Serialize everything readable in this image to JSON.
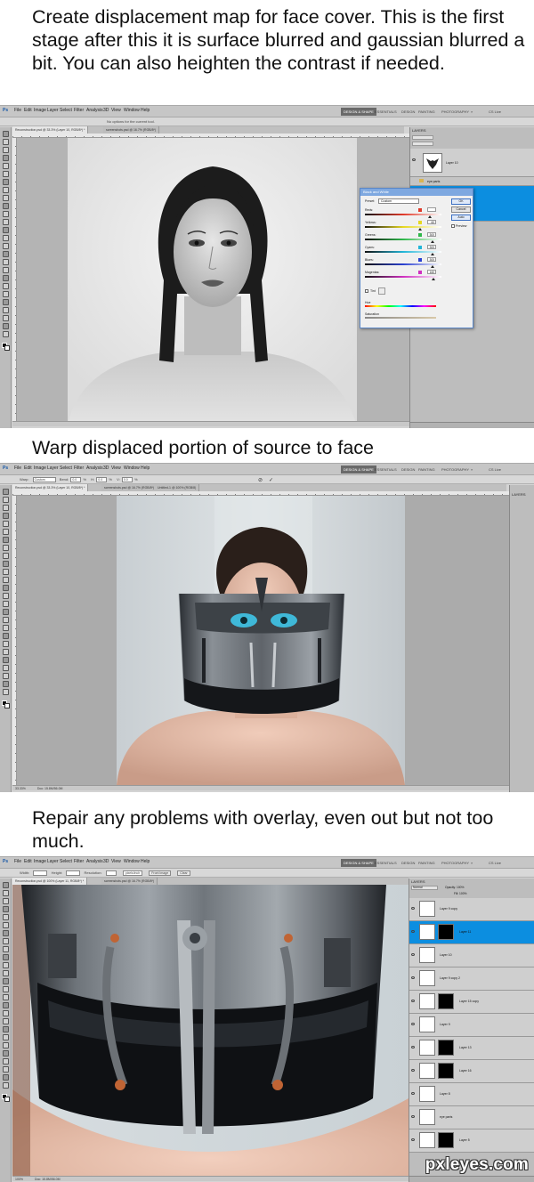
{
  "captions": {
    "step1": "Create displacement map for face cover. This is the first stage after this it is surface blurred and gaussian blurred a bit. You can also heighten the contrast if needed.",
    "step2": "Warp displaced portion of source to face",
    "step3": "Repair any problems with overlay, even out but not too much."
  },
  "ps_menu": [
    "Ps",
    "File",
    "Edit",
    "Image",
    "Layer",
    "Select",
    "Filter",
    "Analysis",
    "3D",
    "View",
    "Window",
    "Help"
  ],
  "workspace": {
    "active": "DESIGN & SHAPE",
    "items": [
      "ESSENTIALS",
      "DESIGN",
      "PAINTING",
      "PHOTOGRAPHY",
      "»"
    ],
    "cslive": "CS Live"
  },
  "screen1": {
    "options_hint": "No options for the current tool.",
    "tabs": [
      "Reconstruction.psd @ 33.3% (Layer 10, RGB/8*) *",
      "screenshots.psd @ 16.7% (RGB/8*)"
    ],
    "layers_title": "LAYERS",
    "layers": [
      {
        "name": "Layer 10",
        "thumb": "mask-icon"
      },
      {
        "name": "eye parts",
        "thumb": "folder-icon"
      },
      {
        "name": "",
        "thumb": "face-icon",
        "selected": true
      }
    ],
    "dialog": {
      "title": "Black and White",
      "preset_label": "Preset:",
      "preset_value": "Custom",
      "buttons": [
        "OK",
        "Cancel",
        "Auto"
      ],
      "preview_label": "Preview",
      "sliders": [
        {
          "label": "Reds:",
          "value": "",
          "color": "#e03a2a",
          "pct": 0.85
        },
        {
          "label": "Yellows:",
          "value": "60",
          "color": "#e6d820",
          "pct": 0.72
        },
        {
          "label": "Greens:",
          "value": "300",
          "color": "#2fb84a",
          "pct": 0.88
        },
        {
          "label": "Cyans:",
          "value": "300",
          "color": "#22b6d8",
          "pct": 0.88
        },
        {
          "label": "Blues:",
          "value": "300",
          "color": "#2a40d0",
          "pct": 0.88
        },
        {
          "label": "Magentas:",
          "value": "160",
          "color": "#d030c0",
          "pct": 0.9
        }
      ],
      "tint_label": "Tint",
      "hue_label": "Hue",
      "saturation_label": "Saturation"
    }
  },
  "screen2": {
    "options": [
      "Warp:",
      "Custom",
      "Bend:",
      "0.0",
      "%",
      "H:",
      "0.0",
      "%",
      "V:",
      "0.0",
      "%"
    ],
    "tabs": [
      "Reconstruction.psd @ 33.3% (Layer 10, RGB/8*) *",
      "screenshots.psd @ 16.7% (RGB/8*)",
      "Untitled-1 @ 100% (RGB/8)"
    ],
    "panel_title": "LAYERS",
    "zoom": "33.33%",
    "doc": "Doc: 15.8M/56.0M"
  },
  "screen3": {
    "options": [
      "Width:",
      "Height:",
      "Resolution:",
      "pixels/inch",
      "Front Image",
      "Clear"
    ],
    "tabs": [
      "Reconstruction.psd @ 100% (Layer 11, RGB/8*) *",
      "screenshots.psd @ 16.7% (RGB/8*)"
    ],
    "layers_title": "LAYERS",
    "blend_mode": "Normal",
    "opacity": "Opacity: 100%",
    "fill": "Fill: 100%",
    "layers": [
      {
        "name": "Layer 9 copy",
        "mask": false,
        "selected": false
      },
      {
        "name": "Layer 11",
        "mask": true,
        "selected": true
      },
      {
        "name": "Layer 10",
        "mask": false,
        "selected": false
      },
      {
        "name": "Layer 9 copy 2",
        "mask": false,
        "selected": false
      },
      {
        "name": "Layer 15 copy",
        "mask": true,
        "selected": false
      },
      {
        "name": "Layer 9",
        "mask": false,
        "selected": false
      },
      {
        "name": "Layer 13",
        "mask": true,
        "selected": false
      },
      {
        "name": "Layer 16",
        "mask": true,
        "selected": false
      },
      {
        "name": "Layer 8",
        "mask": false,
        "selected": false
      },
      {
        "name": "eye parts",
        "mask": false,
        "selected": false
      },
      {
        "name": "Layer 5",
        "mask": true,
        "selected": false
      }
    ],
    "zoom": "100%",
    "doc": "Doc: 15.8M/56.0M"
  },
  "watermark": "pxleyes.com",
  "colors": {
    "selection_blue": "#0c8ee0",
    "workspace_active": "#6a6a6a",
    "dialog_title": "#7ea8e0"
  }
}
